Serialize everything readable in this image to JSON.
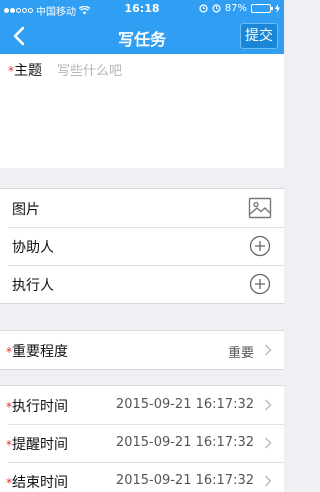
{
  "status_bar": {
    "carrier": "中国移动",
    "time": "16:18",
    "battery_percent": "87%",
    "battery_level": 0.87
  },
  "nav": {
    "back_icon": "chevron-left-icon",
    "title": "写任务",
    "submit_label": "提交"
  },
  "subject": {
    "label": "主题",
    "required_mark": "*",
    "placeholder": "写些什么吧"
  },
  "attachments": {
    "image_label": "图片",
    "image_icon": "image-icon",
    "assistant_label": "协助人",
    "executor_label": "执行人",
    "add_icon": "plus-circle-icon"
  },
  "importance": {
    "label": "重要程度",
    "value": "重要"
  },
  "times": [
    {
      "label": "执行时间",
      "value": "2015-09-21 16:17:32"
    },
    {
      "label": "提醒时间",
      "value": "2015-09-21 16:17:32"
    },
    {
      "label": "结束时间",
      "value": "2015-09-21 16:17:32"
    }
  ],
  "colors": {
    "nav_bg": "#2f9ef3",
    "required": "#e0302b",
    "placeholder": "#b5b5b5"
  }
}
